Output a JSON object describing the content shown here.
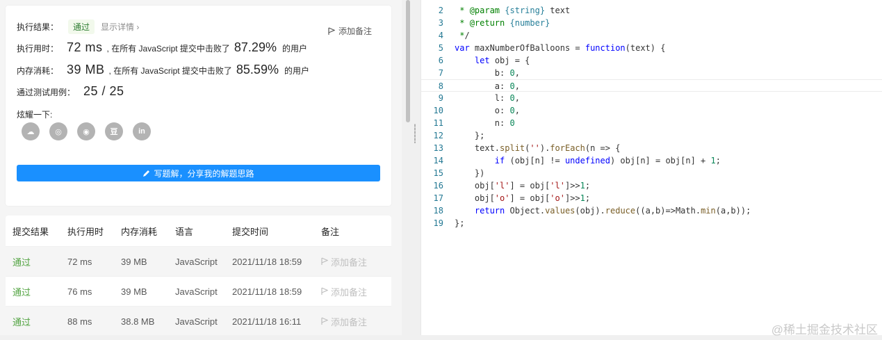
{
  "result": {
    "exec_result_label": "执行结果：",
    "status": "通过",
    "show_details": "显示详情 ›",
    "add_note": "添加备注",
    "runtime_label": "执行用时：",
    "runtime_value": "72 ms",
    "runtime_mid": ", 在所有 JavaScript 提交中击败了",
    "runtime_pct": "87.29%",
    "users_suffix": "的用户",
    "memory_label": "内存消耗：",
    "memory_value": "39 MB",
    "memory_mid": ", 在所有 JavaScript 提交中击败了",
    "memory_pct": "85.59%",
    "tests_label": "通过测试用例：",
    "tests_value": "25 / 25",
    "share_title": "炫耀一下:",
    "share_icons": [
      "wechat-icon",
      "weibo-icon",
      "qq-icon",
      "douban-icon",
      "linkedin-icon"
    ],
    "share_glyphs": [
      "☁",
      "◎",
      "◉",
      "豆",
      "in"
    ],
    "write_solution": "写题解，分享我的解题思路"
  },
  "submissions": {
    "headers": [
      "提交结果",
      "执行用时",
      "内存消耗",
      "语言",
      "提交时间",
      "备注"
    ],
    "rows": [
      {
        "status": "通过",
        "runtime": "72 ms",
        "memory": "39 MB",
        "lang": "JavaScript",
        "time": "2021/11/18 18:59",
        "note": "添加备注"
      },
      {
        "status": "通过",
        "runtime": "76 ms",
        "memory": "39 MB",
        "lang": "JavaScript",
        "time": "2021/11/18 18:59",
        "note": "添加备注"
      },
      {
        "status": "通过",
        "runtime": "88 ms",
        "memory": "38.8 MB",
        "lang": "JavaScript",
        "time": "2021/11/18 16:11",
        "note": "添加备注"
      }
    ]
  },
  "editor": {
    "active_line": 8,
    "lines": [
      {
        "n": "2",
        "text": " * @param {string} text"
      },
      {
        "n": "3",
        "text": " * @return {number}"
      },
      {
        "n": "4",
        "text": " */"
      },
      {
        "n": "5",
        "text": "var maxNumberOfBalloons = function(text) {"
      },
      {
        "n": "6",
        "text": "    let obj = {"
      },
      {
        "n": "7",
        "text": "        b: 0,"
      },
      {
        "n": "8",
        "text": "        a: 0,"
      },
      {
        "n": "9",
        "text": "        l: 0,"
      },
      {
        "n": "10",
        "text": "        o: 0,"
      },
      {
        "n": "11",
        "text": "        n: 0"
      },
      {
        "n": "12",
        "text": "    };"
      },
      {
        "n": "13",
        "text": "    text.split('').forEach(n => {"
      },
      {
        "n": "14",
        "text": "        if (obj[n] != undefined) obj[n] = obj[n] + 1;"
      },
      {
        "n": "15",
        "text": "    })"
      },
      {
        "n": "16",
        "text": "    obj['l'] = obj['l']>>1;"
      },
      {
        "n": "17",
        "text": "    obj['o'] = obj['o']>>1;"
      },
      {
        "n": "18",
        "text": "    return Object.values(obj).reduce((a,b)=>Math.min(a,b));"
      },
      {
        "n": "19",
        "text": "};"
      }
    ]
  },
  "watermark": "@稀土掘金技术社区",
  "colors": {
    "accent": "#1a90ff",
    "pass": "#52a341"
  }
}
